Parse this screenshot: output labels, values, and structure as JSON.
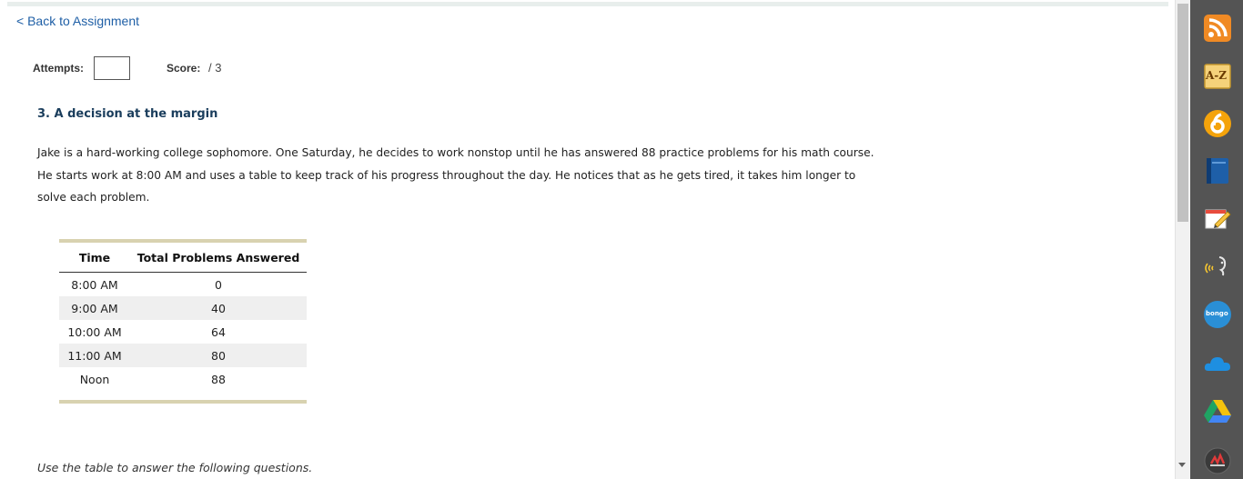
{
  "nav": {
    "back_label": "< Back to Assignment"
  },
  "meta": {
    "attempts_label": "Attempts:",
    "attempts_value": "",
    "score_label": "Score:",
    "score_value": "/ 3"
  },
  "question": {
    "title": "3. A decision at the margin",
    "lines": [
      "Jake is a hard-working college sophomore. One Saturday, he decides to work nonstop until he has answered 88 practice problems for his math course.",
      "He starts work at 8:00 AM and uses a table to keep track of his progress throughout the day. He notices that as he gets tired, it takes him longer to",
      "solve each problem."
    ]
  },
  "table": {
    "headers": [
      "Time",
      "Total Problems Answered"
    ],
    "rows": [
      [
        "8:00 AM",
        "0"
      ],
      [
        "9:00 AM",
        "40"
      ],
      [
        "10:00 AM",
        "64"
      ],
      [
        "11:00 AM",
        "80"
      ],
      [
        "Noon",
        "88"
      ]
    ]
  },
  "footer_instruction": "Use the table to answer the following questions.",
  "extensions": {
    "az_label": "A-Z",
    "bongo_label": "bongo",
    "icons": [
      "rss-icon",
      "a-z-dictionary-icon",
      "six-circle-icon",
      "blue-book-icon",
      "notes-pencil-icon",
      "read-aloud-icon",
      "bongo-icon",
      "onedrive-cloud-icon",
      "google-drive-icon",
      "media-player-icon"
    ]
  },
  "colors": {
    "link": "#1f5fa6",
    "title": "#1a3d5c",
    "table_rule": "#d8d2b0",
    "row_alt": "#efefef",
    "extension_bar": "#545454"
  }
}
